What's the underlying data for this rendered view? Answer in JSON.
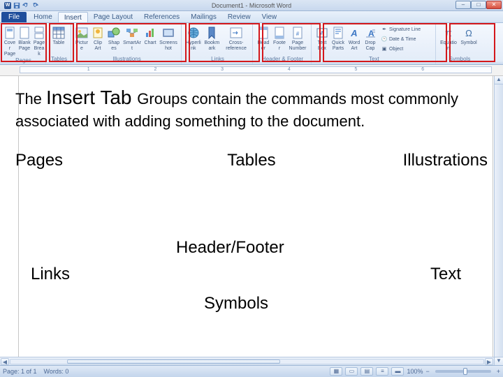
{
  "titlebar": {
    "title": "Document1 - Microsoft Word"
  },
  "tabs": {
    "file": "File",
    "items": [
      "Home",
      "Insert",
      "Page Layout",
      "References",
      "Mailings",
      "Review",
      "View"
    ],
    "active_index": 1
  },
  "ribbon": {
    "pages": {
      "label": "Pages",
      "cover": "Cover Page",
      "blank": "Blank Page",
      "break": "Page Break"
    },
    "tables": {
      "label": "Tables",
      "btn": "Table"
    },
    "illus": {
      "label": "Illustrations",
      "picture": "Picture",
      "clipart": "Clip Art",
      "shapes": "Shapes",
      "smartart": "SmartArt",
      "chart": "Chart",
      "screenshot": "Screenshot"
    },
    "links": {
      "label": "Links",
      "hyper": "Hyperlink",
      "bookmark": "Bookmark",
      "xref": "Cross-reference"
    },
    "hf": {
      "label": "Header & Footer",
      "header": "Header",
      "footer": "Footer",
      "pagenum": "Page Number"
    },
    "text": {
      "label": "Text",
      "textbox": "Text Box",
      "quick": "Quick Parts",
      "wordart": "WordArt",
      "dropcap": "Drop Cap",
      "sig": "Signature Line",
      "date": "Date & Time",
      "obj": "Object"
    },
    "symbols": {
      "label": "Symbols",
      "eq": "Equation",
      "sym": "Symbol"
    }
  },
  "ruler": {
    "nums": [
      "",
      "1",
      "2",
      "3",
      "4",
      "5",
      "6",
      ""
    ]
  },
  "overlay": {
    "para_pre": "The ",
    "para_big": "Insert Tab ",
    "para_post": "Groups contain the commands most commonly associated with adding something to the document.",
    "terms": {
      "pages": "Pages",
      "tables": "Tables",
      "illus": "Illustrations",
      "hf": "Header/Footer",
      "links": "Links",
      "text": "Text",
      "symbols": "Symbols"
    }
  },
  "status": {
    "page": "Page: 1 of 1",
    "words": "Words: 0",
    "zoom": "100%",
    "minus": "−",
    "plus": "+"
  }
}
